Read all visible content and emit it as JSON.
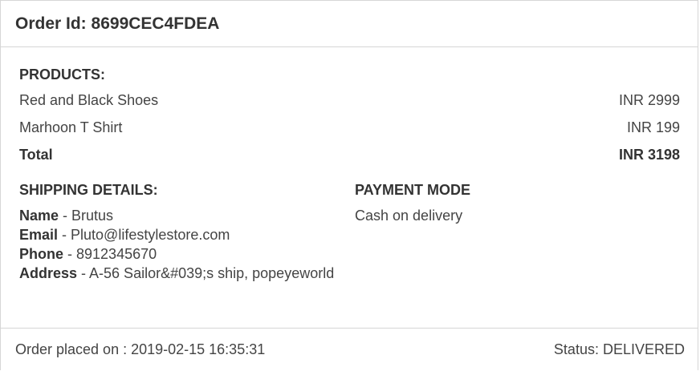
{
  "order": {
    "id_label": "Order Id:",
    "id": "8699CEC4FDEA"
  },
  "products": {
    "title": "PRODUCTS:",
    "items": [
      {
        "name": "Red and Black Shoes",
        "price": "INR 2999"
      },
      {
        "name": "Marhoon T Shirt",
        "price": "INR 199"
      }
    ],
    "total_label": "Total",
    "total_value": "INR 3198"
  },
  "shipping": {
    "title": "SHIPPING DETAILS:",
    "name_label": "Name",
    "name_value": " - Brutus",
    "email_label": "Email",
    "email_value": " - Pluto@lifestylestore.com",
    "phone_label": "Phone",
    "phone_value": " - 8912345670",
    "address_label": "Address",
    "address_value": " - A-56 Sailor&#039;s ship, popeyeworld"
  },
  "payment": {
    "title": "PAYMENT MODE",
    "value": "Cash on delivery"
  },
  "footer": {
    "placed_on": "Order placed on : 2019-02-15 16:35:31",
    "status": "Status: DELIVERED"
  }
}
